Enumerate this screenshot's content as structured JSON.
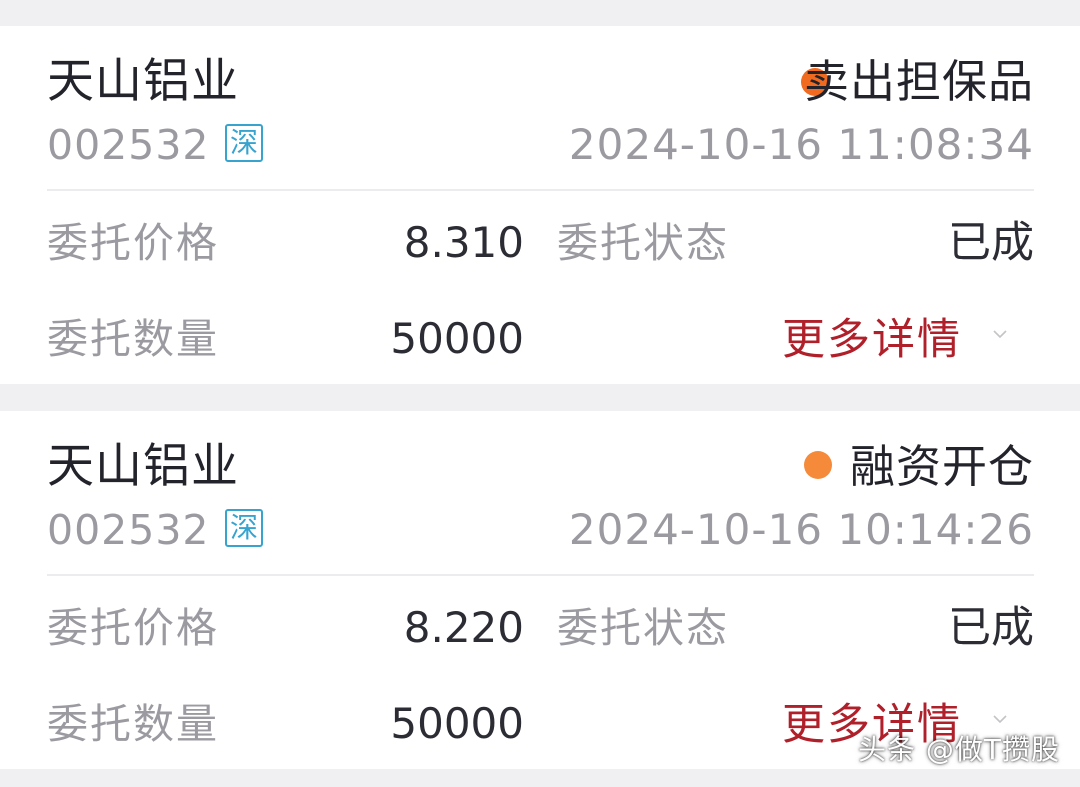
{
  "orders": [
    {
      "stock_name": "天山铝业",
      "stock_code": "002532",
      "market_badge": "深",
      "order_type": "卖出担保品",
      "order_type_dot_color": "#f06a1f",
      "datetime": "2024-10-16 11:08:34",
      "price_label": "委托价格",
      "price_value": "8.310",
      "status_label": "委托状态",
      "status_value": "已成",
      "quantity_label": "委托数量",
      "quantity_value": "50000",
      "more_details": "更多详情",
      "chevron_icon": "chevron-down-icon"
    },
    {
      "stock_name": "天山铝业",
      "stock_code": "002532",
      "market_badge": "深",
      "order_type": "融资开仓",
      "order_type_dot_color": "#f58a3a",
      "datetime": "2024-10-16 10:14:26",
      "price_label": "委托价格",
      "price_value": "8.220",
      "status_label": "委托状态",
      "status_value": "已成",
      "quantity_label": "委托数量",
      "quantity_value": "50000",
      "more_details": "更多详情",
      "chevron_icon": "chevron-down-icon"
    }
  ],
  "watermark": "头条 @做T攒股",
  "colors": {
    "background": "#f0f0f2",
    "card": "#ffffff",
    "link_red": "#b0202a",
    "badge_blue": "#37a3cf"
  }
}
